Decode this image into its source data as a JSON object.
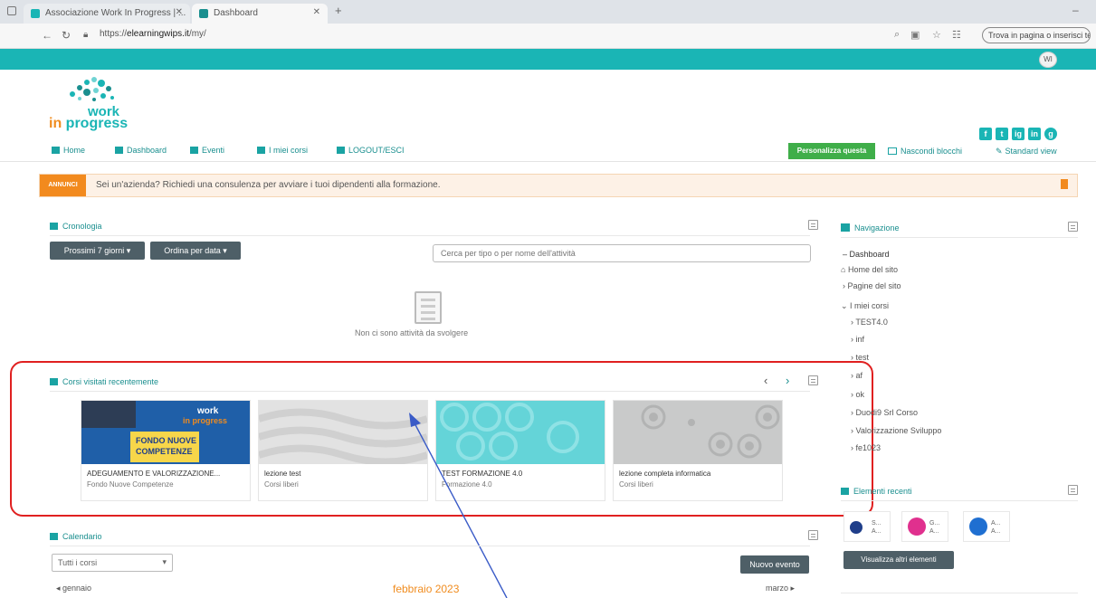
{
  "browser": {
    "tabs": [
      {
        "label": "Associazione Work In Progress | ..."
      },
      {
        "label": "Dashboard"
      }
    ],
    "url_prefix": "https://",
    "url_domain": "elearningwips.it",
    "url_path": "/my/",
    "find_box": "Trova in pagina o inserisci testo"
  },
  "header": {
    "avatar": "WI",
    "logo_top": "work",
    "logo_in": "in",
    "logo_bottom": "progress",
    "social": [
      "f",
      "t",
      "ig",
      "in",
      "g"
    ]
  },
  "nav": {
    "items": [
      "Home",
      "Dashboard",
      "Eventi",
      "I miei corsi",
      "LOGOUT/ESCI"
    ],
    "personalize": "Personalizza questa pagina",
    "manage_blocks": "Nascondi blocchi",
    "standard_view": "Standard view"
  },
  "announcement": {
    "tag": "ANNUNCI",
    "text": "Sei un'azienda? Richiedi una consulenza per avviare i tuoi dipendenti alla formazione."
  },
  "timeline": {
    "title": "Cronologia",
    "filter_days": "Prossimi 7 giorni",
    "sort": "Ordina per data",
    "search_placeholder": "Cerca per tipo o per nome dell'attività",
    "empty": "Non ci sono attività da svolgere"
  },
  "recent_courses": {
    "title": "Corsi visitati recentemente",
    "courses": [
      {
        "name": "ADEGUAMENTO E VALORIZZAZIONE...",
        "category": "Fondo Nuove Competenze",
        "banner_a": "work",
        "banner_b": "in progress",
        "banner_c": "FONDO NUOVE",
        "banner_d": "COMPETENZE"
      },
      {
        "name": "lezione test",
        "category": "Corsi liberi"
      },
      {
        "name": "TEST FORMAZIONE 4.0",
        "category": "Formazione 4.0"
      },
      {
        "name": "lezione completa informatica",
        "category": "Corsi liberi"
      }
    ]
  },
  "calendar": {
    "title": "Calendario",
    "filter": "Tutti i corsi",
    "new_event": "Nuovo evento",
    "prev_month": "gennaio",
    "month": "febbraio 2023",
    "next_month": "marzo"
  },
  "navigation": {
    "title": "Navigazione",
    "items": [
      "Dashboard",
      "Home del sito",
      "Pagine del sito",
      "I miei corsi",
      "TEST4.0",
      "inf",
      "test",
      "af",
      "ok",
      "Duodi9 Srl Corso",
      "Valorizzazione Sviluppo",
      "fe1023"
    ]
  },
  "recent_items": {
    "title": "Elementi recenti",
    "items": [
      {
        "line1": "S...",
        "line2": "A..."
      },
      {
        "line1": "G...",
        "line2": "A..."
      },
      {
        "line1": "A...",
        "line2": "A..."
      }
    ],
    "more": "Visualizza altri elementi"
  },
  "colors": {
    "teal": "#1ab5b5",
    "orange": "#f28a1e",
    "green": "#3fae49",
    "highlight_red": "#e02020",
    "arrow_blue": "#3a5bc7"
  }
}
